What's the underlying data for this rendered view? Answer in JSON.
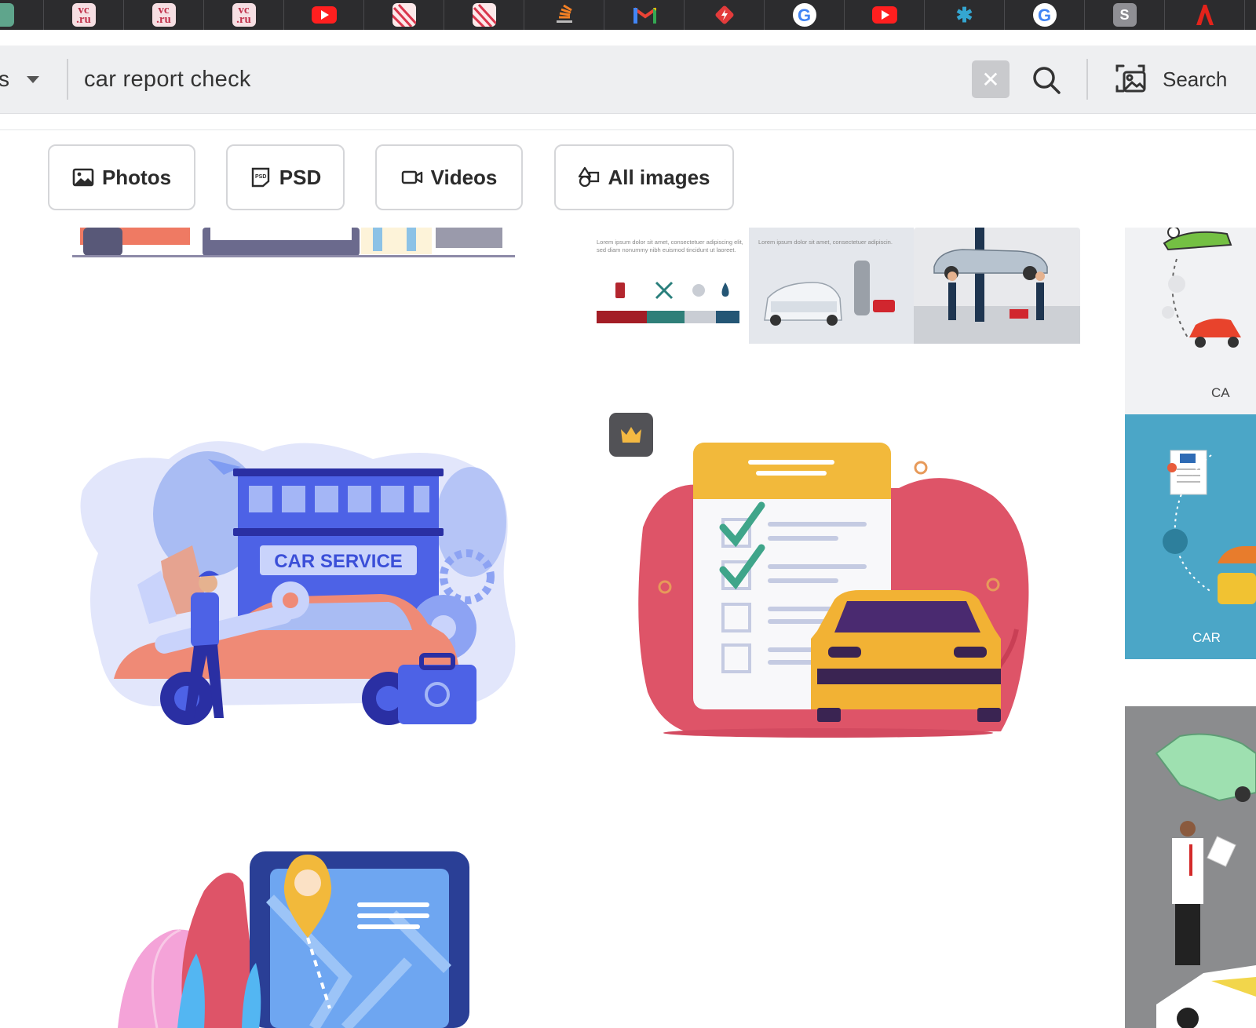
{
  "browser": {
    "tabs": [
      {
        "icon": "chatgpt-icon",
        "label": ""
      },
      {
        "icon": "vc-ru-icon",
        "label": "vc\n.ru"
      },
      {
        "icon": "vc-ru-icon",
        "label": "vc\n.ru"
      },
      {
        "icon": "vc-ru-icon",
        "label": "vc\n.ru"
      },
      {
        "icon": "youtube-icon",
        "label": ""
      },
      {
        "icon": "stripes-icon",
        "label": ""
      },
      {
        "icon": "stripes-icon",
        "label": ""
      },
      {
        "icon": "stackoverflow-icon",
        "label": ""
      },
      {
        "icon": "gmail-icon",
        "label": "M"
      },
      {
        "icon": "diamond-icon",
        "label": ""
      },
      {
        "icon": "google-icon",
        "label": "G"
      },
      {
        "icon": "youtube-icon",
        "label": ""
      },
      {
        "icon": "puzzle-icon",
        "label": "✱"
      },
      {
        "icon": "google-icon",
        "label": "G"
      },
      {
        "icon": "s-icon",
        "label": "S"
      },
      {
        "icon": "adobe-icon",
        "label": ""
      }
    ]
  },
  "search": {
    "type_partial": "s",
    "query": "car report check",
    "clear_label": "✕",
    "image_search_label": "Search"
  },
  "filters": [
    {
      "label": "Photos",
      "icon": "photo-icon"
    },
    {
      "label": "PSD",
      "icon": "psd-icon"
    },
    {
      "label": "Videos",
      "icon": "video-icon"
    },
    {
      "label": "All images",
      "icon": "shapes-icon"
    }
  ],
  "results": {
    "car_service_sign": "CAR SERVICE",
    "card_text_1": "Lorem ipsum dolor sit amet, consectetuer adipiscing elit, sed diam nonummy nibh euismod tincidunt ut laoreet.",
    "card_text_2": "Lorem ipsum dolor sit amet, consectetuer adipiscin.",
    "right_label_1": "CA",
    "right_label_2": "CAR"
  },
  "colors": {
    "tabstrip": "#2c2c2e",
    "searchbar": "#eeeff1",
    "chip_border": "#d5d6d9",
    "premium_badge": "#525256",
    "crown": "#f4b942"
  }
}
